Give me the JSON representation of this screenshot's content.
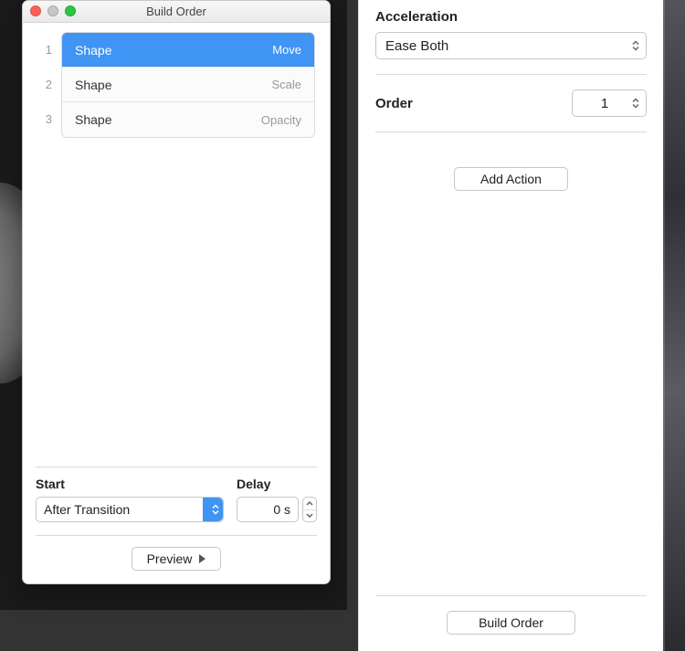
{
  "window": {
    "title": "Build Order",
    "traffic": {
      "close": "close-icon",
      "minimize": "minimize-icon",
      "zoom": "zoom-icon"
    }
  },
  "builds": [
    {
      "index": "1",
      "name": "Shape",
      "effect": "Move",
      "selected": true
    },
    {
      "index": "2",
      "name": "Shape",
      "effect": "Scale",
      "selected": false
    },
    {
      "index": "3",
      "name": "Shape",
      "effect": "Opacity",
      "selected": false
    }
  ],
  "start": {
    "label": "Start",
    "value": "After Transition"
  },
  "delay": {
    "label": "Delay",
    "value": "0 s"
  },
  "preview_label": "Preview",
  "inspector": {
    "acceleration": {
      "label": "Acceleration",
      "value": "Ease Both"
    },
    "order": {
      "label": "Order",
      "value": "1"
    },
    "add_action_label": "Add Action",
    "build_order_label": "Build Order"
  }
}
